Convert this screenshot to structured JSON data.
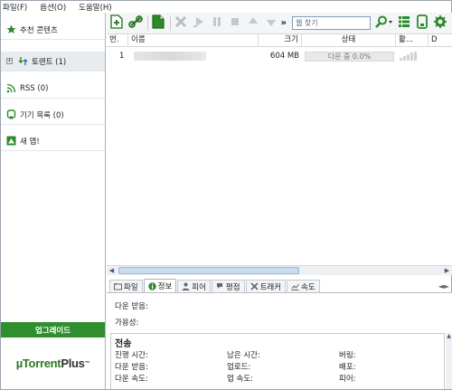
{
  "menu": [
    "파일(F)",
    "옵션(O)",
    "도움말(H)"
  ],
  "sidebar": {
    "items": [
      {
        "label": "추천 콘텐츠",
        "icon": "star-icon"
      },
      {
        "label": "토렌트 (1)",
        "icon": "torrents-icon",
        "selected": true
      },
      {
        "label": "RSS (0)",
        "icon": "rss-icon"
      },
      {
        "label": "기기 목록 (0)",
        "icon": "device-icon"
      },
      {
        "label": "새 앱!",
        "icon": "apps-icon"
      }
    ],
    "upgrade_label": "업그레이드",
    "logo_text": "µTorrent",
    "logo_plus": "Plus",
    "logo_tm": "™"
  },
  "toolbar": {
    "more": "»",
    "search_placeholder": "웹 찾기",
    "buttons": [
      "add-torrent-icon",
      "add-url-icon",
      "create-torrent-icon",
      "remove-icon",
      "start-icon",
      "pause-icon",
      "stop-icon",
      "move-up-icon",
      "move-down-icon",
      "search-icon",
      "list-view-icon",
      "remote-icon",
      "settings-icon"
    ]
  },
  "list": {
    "columns": [
      "번.",
      "이름",
      "크기",
      "상태",
      "활...",
      "D"
    ],
    "rows": [
      {
        "num": "1",
        "name": "",
        "size": "604 MB",
        "status": "다운 중 0.0%",
        "progress": 0.0
      }
    ]
  },
  "tabs": [
    {
      "label": "파일",
      "icon": "files-icon"
    },
    {
      "label": "정보",
      "icon": "info-icon",
      "active": true
    },
    {
      "label": "피어",
      "icon": "peers-icon"
    },
    {
      "label": "평점",
      "icon": "ratings-icon"
    },
    {
      "label": "트래커",
      "icon": "trackers-icon"
    },
    {
      "label": "속도",
      "icon": "speed-icon"
    }
  ],
  "info": {
    "downloaded_label": "다운 받음:",
    "availability_label": "가용성:",
    "transfer_title": "전송",
    "col1": [
      "진행 시간:",
      "다운 받음:",
      "다운 속도:"
    ],
    "col2": [
      "남은 시간:",
      "업로드:",
      "업 속도:"
    ],
    "col3": [
      "버림:",
      "배포:",
      "피어:"
    ]
  },
  "colors": {
    "accent_green": "#2f8f2f",
    "progress_green": "#79c25b"
  }
}
